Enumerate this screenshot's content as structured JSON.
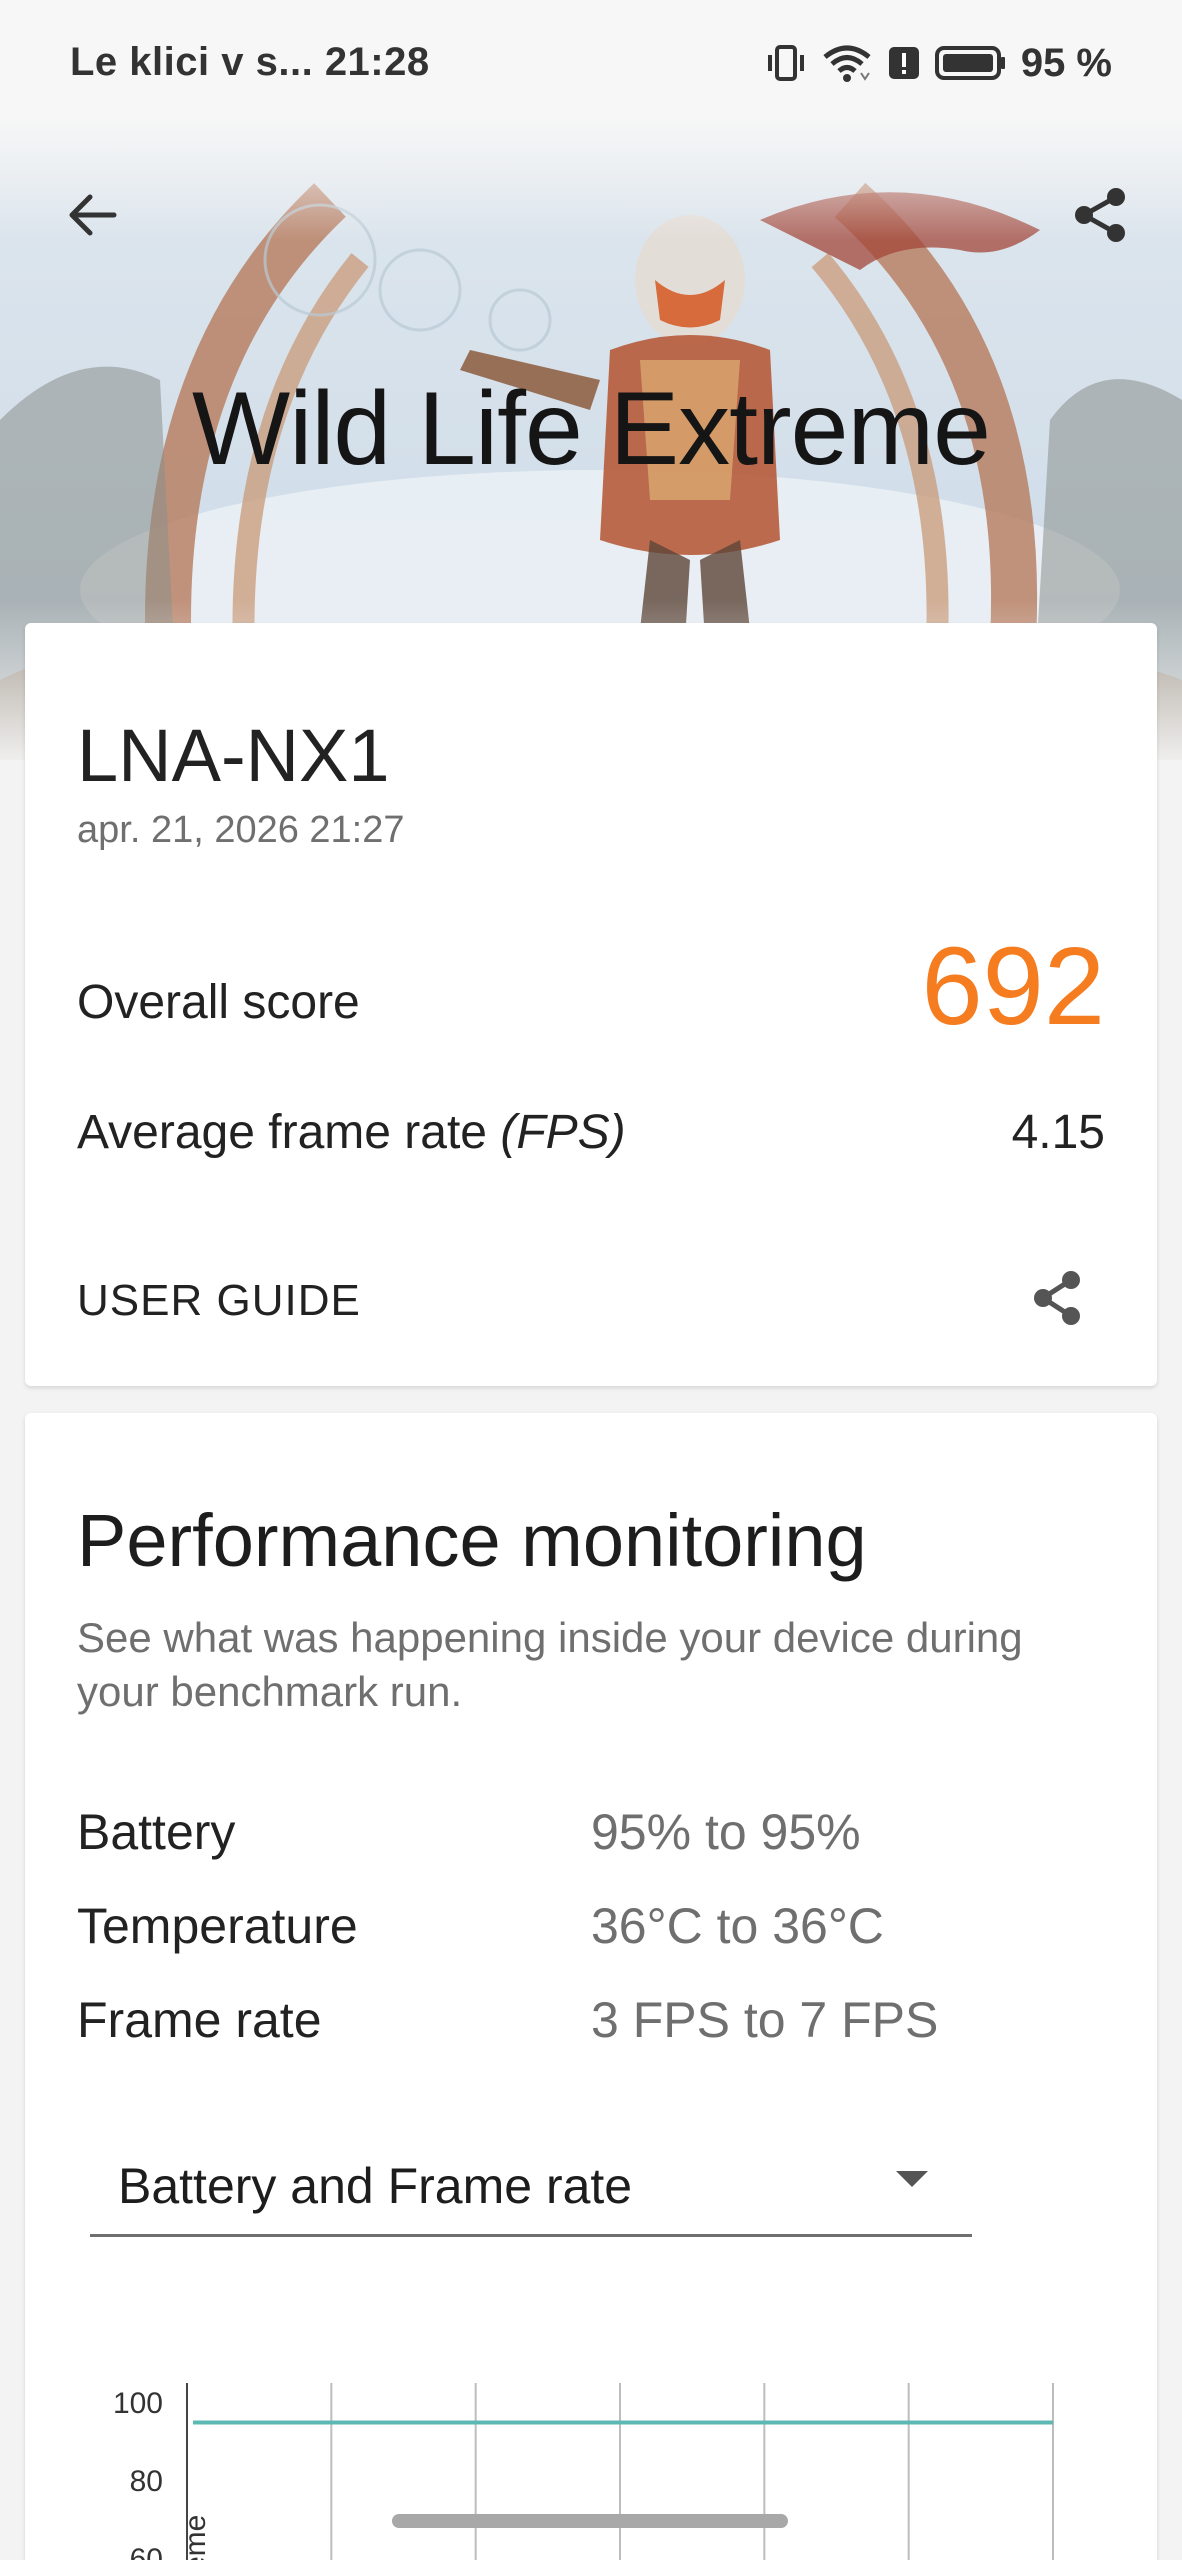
{
  "status_bar": {
    "notification_text": "Le klici v s...",
    "time": "21:28",
    "battery_percent": "95 %",
    "icons": [
      "vibrate-icon",
      "wifi-icon",
      "alert-icon",
      "battery-icon"
    ]
  },
  "hero": {
    "title": "Wild Life Extreme"
  },
  "result": {
    "device_name": "LNA-NX1",
    "date": "apr. 21, 2026 21:27",
    "overall_label": "Overall score",
    "overall_value": "692",
    "fps_label": "Average frame rate ",
    "fps_unit": "(FPS)",
    "fps_value": "4.15",
    "user_guide": "USER GUIDE"
  },
  "performance": {
    "title": "Performance monitoring",
    "subtitle": "See what was happening inside your device during your benchmark run.",
    "metrics": [
      {
        "label": "Battery",
        "value": "95% to 95%"
      },
      {
        "label": "Temperature",
        "value": "36°C to 36°C"
      },
      {
        "label": "Frame rate",
        "value": "3 FPS to 7 FPS"
      }
    ],
    "dropdown_value": "Battery and Frame rate"
  },
  "colors": {
    "accent_score": "#f57c1f",
    "chart_line": "#5db8b3"
  },
  "chart_data": {
    "type": "line",
    "y_ticks": [
      "100",
      "80",
      "60"
    ],
    "ylim": [
      60,
      100
    ],
    "ylabel": "eme",
    "series": [
      {
        "values": [
          95,
          95,
          95,
          95,
          95,
          95,
          95
        ]
      }
    ],
    "grid": true
  }
}
